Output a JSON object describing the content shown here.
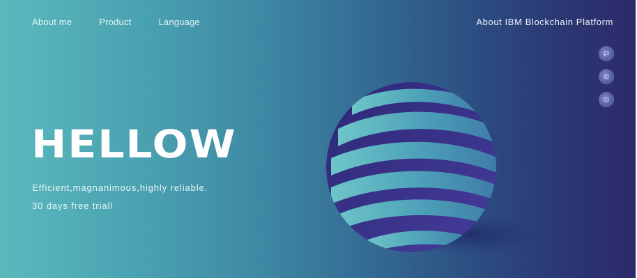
{
  "nav": {
    "items": [
      {
        "label": "About me"
      },
      {
        "label": "Product"
      },
      {
        "label": "Language"
      }
    ],
    "right_link": "About IBM Blockchain Platform"
  },
  "side_icons": [
    {
      "icon": "chat-icon"
    },
    {
      "icon": "share-icon"
    },
    {
      "icon": "mail-icon"
    }
  ],
  "hero": {
    "headline": "HELLOW",
    "tagline": "Efficient,magnanimous,highly reliable.",
    "trial_text": "30 days free triall"
  },
  "colors": {
    "gradient_start": "#5ab9bd",
    "gradient_end": "#2c2a6a",
    "globe_band": "#5fb3bf",
    "globe_inner": "#3a2f83"
  }
}
